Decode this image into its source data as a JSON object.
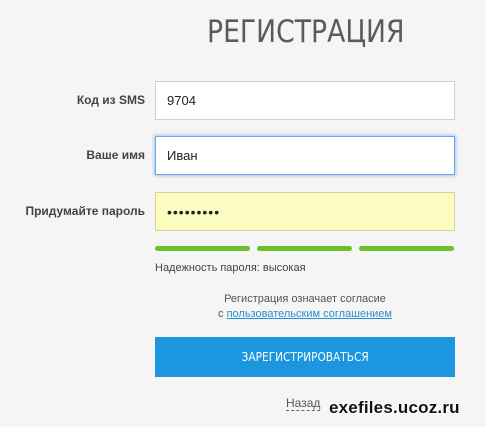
{
  "page": {
    "title": "РЕГИСТРАЦИЯ"
  },
  "form": {
    "sms": {
      "label": "Код из SMS",
      "value": "9704"
    },
    "name": {
      "label": "Ваше имя",
      "value": "Иван"
    },
    "password": {
      "label": "Придумайте пароль",
      "value": "•••••••••"
    },
    "strength": {
      "label": "Надежность пароля:",
      "level_text": "высокая",
      "filled_segments": 3,
      "total_segments": 3
    },
    "agreement": {
      "prefix": "Регистрация означает согласие",
      "link_prefix": "с",
      "link_text": "пользовательским соглашением"
    },
    "submit_label": "ЗАРЕГИСТРИРОВАТЬСЯ",
    "back_label": "Назад"
  },
  "watermark": "exefiles.ucoz.ru",
  "colors": {
    "accent": "#1b96df",
    "strength": "#6cc12a",
    "link": "#2a8fd0",
    "autofill": "#fafcc0",
    "focus": "#6aa6e8"
  }
}
